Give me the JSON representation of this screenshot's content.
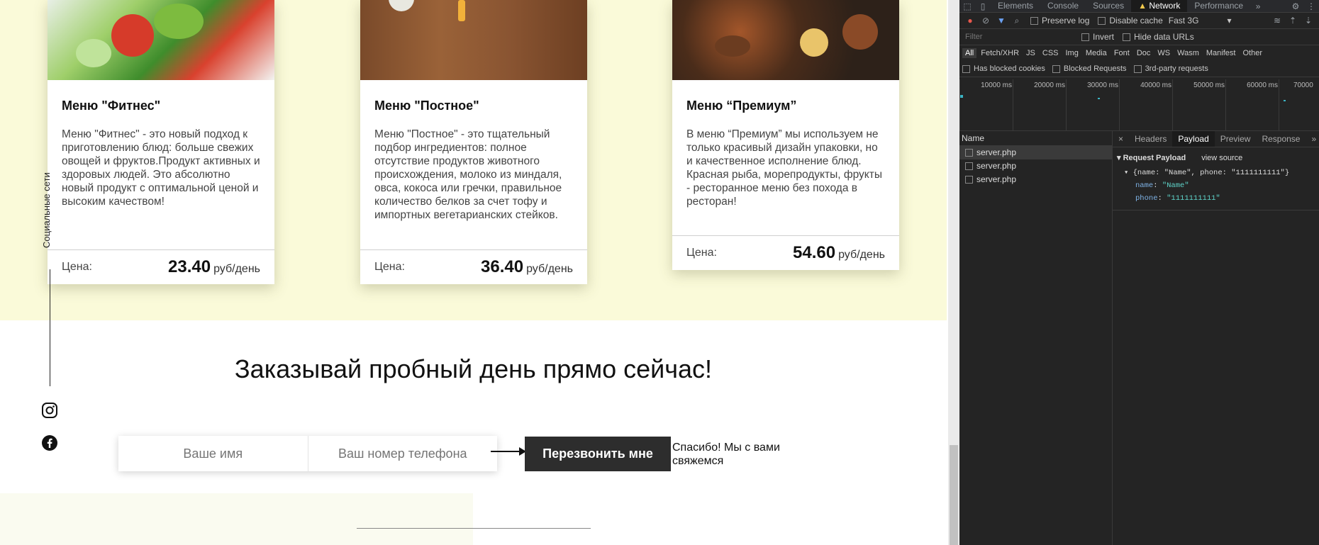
{
  "cards": [
    {
      "title": "Меню \"Фитнес\"",
      "description": "Меню \"Фитнес\" - это новый подход к приготовлению блюд: больше свежих овощей и фруктов.Продукт активных и здоровых людей. Это абсолютно новый продукт с оптимальной ценой и высоким качеством!",
      "price_label": "Цена:",
      "price": "23.40",
      "unit": "руб/день"
    },
    {
      "title": "Меню \"Постное\"",
      "description": "Меню \"Постное\" - это тщательный подбор ингредиентов: полное отсутствие продуктов животного происхождения, молоко из миндаля, овса, кокоса или гречки, правильное количество белков за счет тофу и импортных вегетарианских стейков.",
      "price_label": "Цена:",
      "price": "36.40",
      "unit": "руб/день"
    },
    {
      "title": "Меню “Премиум”",
      "description": "В меню “Премиум” мы используем не только красивый дизайн упаковки, но и качественное исполнение блюд. Красная рыба, морепродукты, фрукты - ресторанное меню без похода в ресторан!",
      "price_label": "Цена:",
      "price": "54.60",
      "unit": "руб/день"
    }
  ],
  "social": {
    "label": "Социальные сети",
    "icons": [
      "instagram-icon",
      "facebook-icon"
    ]
  },
  "cta": {
    "title": "Заказывай пробный день прямо сейчас!",
    "name_placeholder": "Ваше имя",
    "phone_placeholder": "Ваш номер телефона",
    "button": "Перезвонить мне",
    "thanks": "Спасибо! Мы с вами свяжемся"
  },
  "devtools": {
    "tabs": [
      "Elements",
      "Console",
      "Sources",
      "Network",
      "Performance"
    ],
    "active_tab": "Network",
    "toolbar": {
      "preserve_log": "Preserve log",
      "disable_cache": "Disable cache",
      "throttle": "Fast 3G"
    },
    "filter": {
      "placeholder": "Filter",
      "invert": "Invert",
      "hide_data_urls": "Hide data URLs"
    },
    "types": [
      "All",
      "Fetch/XHR",
      "JS",
      "CSS",
      "Img",
      "Media",
      "Font",
      "Doc",
      "WS",
      "Wasm",
      "Manifest",
      "Other"
    ],
    "checks": [
      "Has blocked cookies",
      "Blocked Requests",
      "3rd-party requests"
    ],
    "timeline_ticks": [
      "10000 ms",
      "20000 ms",
      "30000 ms",
      "40000 ms",
      "50000 ms",
      "60000 ms",
      "70000"
    ],
    "name_header": "Name",
    "requests": [
      "server.php",
      "server.php",
      "server.php"
    ],
    "detail_tabs": [
      "Headers",
      "Payload",
      "Preview",
      "Response"
    ],
    "active_detail_tab": "Payload",
    "payload": {
      "title": "Request Payload",
      "view_source": "view source",
      "summary": "{name: \"Name\", phone: \"1111111111\"}",
      "name_key": "name",
      "name_value": "\"Name\"",
      "phone_key": "phone",
      "phone_value": "\"1111111111\""
    }
  },
  "colors": {
    "band": "#fafad9",
    "button": "#2d2d2d",
    "devtools_bg": "#242424",
    "accent_string": "#5fd3c9"
  }
}
